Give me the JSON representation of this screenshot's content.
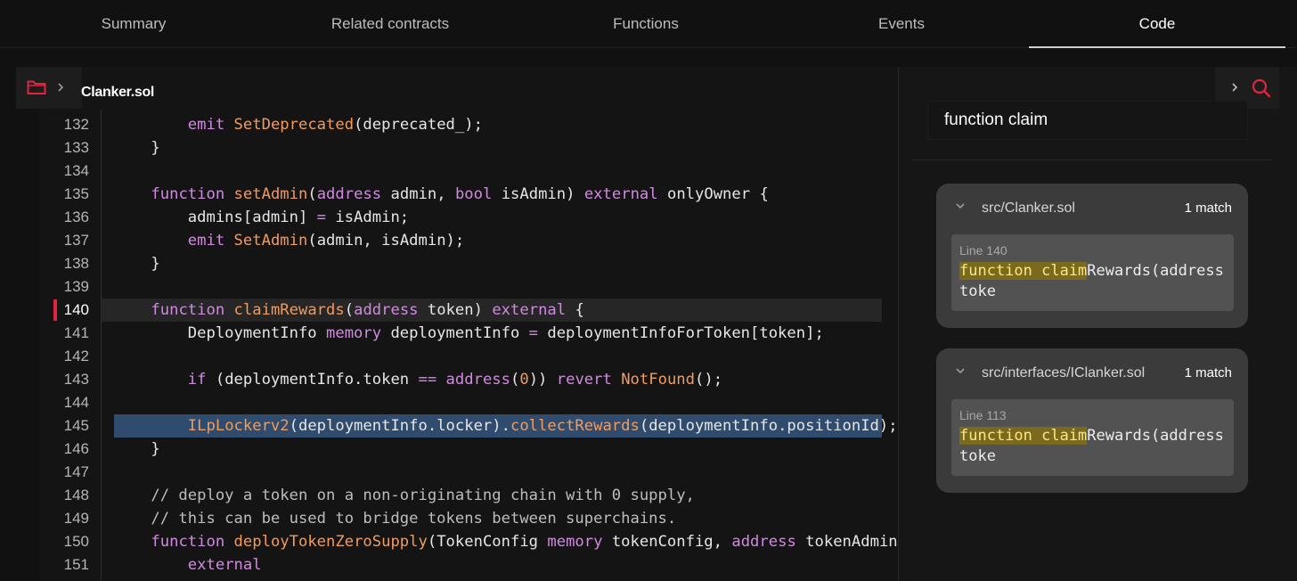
{
  "tabs": [
    {
      "label": "Summary",
      "active": false
    },
    {
      "label": "Related contracts",
      "active": false
    },
    {
      "label": "Functions",
      "active": false
    },
    {
      "label": "Events",
      "active": false
    },
    {
      "label": "Code",
      "active": true
    }
  ],
  "editor": {
    "file_name": "Clanker.sol",
    "current_line": 140,
    "selected_line": 145,
    "lines": [
      {
        "n": "132",
        "tokens": [
          [
            "",
            "        "
          ],
          [
            "kw",
            "emit "
          ],
          [
            "fn",
            "SetDeprecated"
          ],
          [
            "",
            "(deprecated_);"
          ]
        ]
      },
      {
        "n": "133",
        "tokens": [
          [
            "",
            "    }"
          ]
        ]
      },
      {
        "n": "134",
        "tokens": [
          [
            "",
            ""
          ]
        ]
      },
      {
        "n": "135",
        "tokens": [
          [
            "",
            "    "
          ],
          [
            "kw",
            "function "
          ],
          [
            "fn",
            "setAdmin"
          ],
          [
            "",
            "("
          ],
          [
            "kw",
            "address "
          ],
          [
            "",
            "admin, "
          ],
          [
            "kw",
            "bool "
          ],
          [
            "",
            "isAdmin) "
          ],
          [
            "kw",
            "external "
          ],
          [
            "",
            "onlyOwner {"
          ]
        ]
      },
      {
        "n": "136",
        "tokens": [
          [
            "",
            "        admins[admin] "
          ],
          [
            "kw",
            "= "
          ],
          [
            "",
            "isAdmin;"
          ]
        ]
      },
      {
        "n": "137",
        "tokens": [
          [
            "",
            "        "
          ],
          [
            "kw",
            "emit "
          ],
          [
            "fn",
            "SetAdmin"
          ],
          [
            "",
            "(admin, isAdmin);"
          ]
        ]
      },
      {
        "n": "138",
        "tokens": [
          [
            "",
            "    }"
          ]
        ]
      },
      {
        "n": "139",
        "tokens": [
          [
            "",
            ""
          ]
        ]
      },
      {
        "n": "140",
        "tokens": [
          [
            "",
            "    "
          ],
          [
            "kw",
            "function "
          ],
          [
            "fn",
            "claimRewards"
          ],
          [
            "",
            "("
          ],
          [
            "kw",
            "address "
          ],
          [
            "",
            "token) "
          ],
          [
            "kw",
            "external "
          ],
          [
            "",
            "{"
          ]
        ]
      },
      {
        "n": "141",
        "tokens": [
          [
            "",
            "        DeploymentInfo "
          ],
          [
            "kw",
            "memory "
          ],
          [
            "",
            "deploymentInfo "
          ],
          [
            "kw",
            "= "
          ],
          [
            "",
            "deploymentInfoForToken[token];"
          ]
        ]
      },
      {
        "n": "142",
        "tokens": [
          [
            "",
            ""
          ]
        ]
      },
      {
        "n": "143",
        "tokens": [
          [
            "",
            "        "
          ],
          [
            "kw",
            "if "
          ],
          [
            "",
            "(deploymentInfo.token "
          ],
          [
            "kw",
            "== "
          ],
          [
            "kw",
            "address"
          ],
          [
            "",
            "("
          ],
          [
            "nm",
            "0"
          ],
          [
            "",
            "))"
          ],
          [
            "kw",
            " revert "
          ],
          [
            "fn",
            "NotFound"
          ],
          [
            "",
            "();"
          ]
        ]
      },
      {
        "n": "144",
        "tokens": [
          [
            "",
            ""
          ]
        ]
      },
      {
        "n": "145",
        "tokens": [
          [
            "",
            "        "
          ],
          [
            "fn",
            "ILpLockerv2"
          ],
          [
            "",
            "(deploymentInfo.locker)."
          ],
          [
            "fn",
            "collectRewards"
          ],
          [
            "",
            "(deploymentInfo.positionId);"
          ]
        ]
      },
      {
        "n": "146",
        "tokens": [
          [
            "",
            "    }"
          ]
        ]
      },
      {
        "n": "147",
        "tokens": [
          [
            "",
            ""
          ]
        ]
      },
      {
        "n": "148",
        "tokens": [
          [
            "cm",
            "    // deploy a token on a non-originating chain with 0 supply,"
          ]
        ]
      },
      {
        "n": "149",
        "tokens": [
          [
            "cm",
            "    // this can be used to bridge tokens between superchains."
          ]
        ]
      },
      {
        "n": "150",
        "tokens": [
          [
            "",
            "    "
          ],
          [
            "kw",
            "function "
          ],
          [
            "fn",
            "deployTokenZeroSupply"
          ],
          [
            "",
            "(TokenConfig "
          ],
          [
            "kw",
            "memory "
          ],
          [
            "",
            "tokenConfig, "
          ],
          [
            "kw",
            "address "
          ],
          [
            "",
            "tokenAdmin"
          ]
        ]
      },
      {
        "n": "151",
        "tokens": [
          [
            "",
            "        "
          ],
          [
            "kw",
            "external"
          ]
        ]
      }
    ]
  },
  "search": {
    "query": "function claim",
    "results": [
      {
        "path": "src/Clanker.sol",
        "count": "1 match",
        "line_label": "Line 140",
        "match_text": "function claim",
        "rest_text": "Rewards(address toke"
      },
      {
        "path": "src/interfaces/IClanker.sol",
        "count": "1 match",
        "line_label": "Line 113",
        "match_text": "function claim",
        "rest_text": "Rewards(address toke"
      }
    ]
  },
  "colors": {
    "accent_red": "#e0253f",
    "keyword": "#d08bdf",
    "function": "#f29b5e",
    "selection": "#2f4c6f",
    "match_highlight": "#7a6a1e"
  },
  "icons": [
    "folder-icon",
    "chevron-right-icon",
    "search-icon",
    "chevron-down-icon"
  ]
}
